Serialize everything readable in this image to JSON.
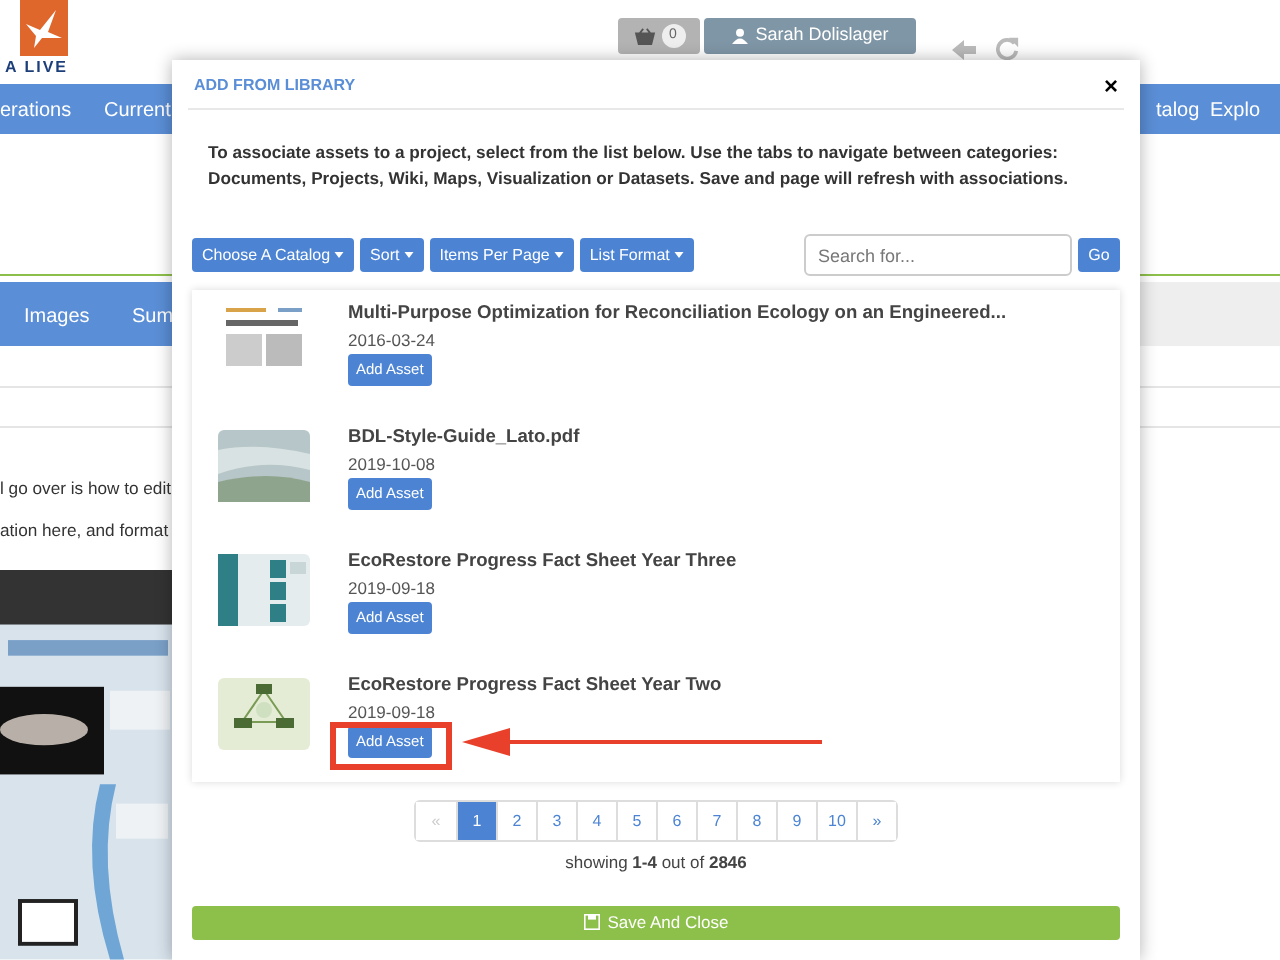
{
  "page": {
    "logo_text": "A LIVE",
    "cart_count": "0",
    "user": "Sarah Dolislager",
    "nav": [
      "erations",
      "Current",
      "talog",
      "Explo"
    ],
    "subnav": [
      "Images",
      "Sum"
    ],
    "body_lines": [
      "l go over is how to edit",
      "ation here, and format"
    ]
  },
  "modal": {
    "title": "ADD FROM LIBRARY",
    "close": "×",
    "description": "To associate assets to a project, select from the list below. Use the tabs to navigate between categories: Documents, Projects, Wiki, Maps, Visualization or Datasets. Save and page will refresh with associations.",
    "toolbar": [
      "Choose A Catalog",
      "Sort",
      "Items Per Page",
      "List Format"
    ],
    "search": {
      "placeholder": "Search for...",
      "button": "Go"
    },
    "assets": [
      {
        "title": "Multi-Purpose Optimization for Reconciliation Ecology on an Engineered...",
        "date": "2016-03-24",
        "button": "Add Asset",
        "highlighted": false
      },
      {
        "title": "BDL-Style-Guide_Lato.pdf",
        "date": "2019-10-08",
        "button": "Add Asset",
        "highlighted": false
      },
      {
        "title": "EcoRestore Progress Fact Sheet Year Three",
        "date": "2019-09-18",
        "button": "Add Asset",
        "highlighted": false
      },
      {
        "title": "EcoRestore Progress Fact Sheet Year Two",
        "date": "2019-09-18",
        "button": "Add Asset",
        "highlighted": true
      }
    ],
    "pagination": [
      {
        "label": "«",
        "selected": false,
        "disabled": true
      },
      {
        "label": "1",
        "selected": true,
        "disabled": false
      },
      {
        "label": "2",
        "selected": false,
        "disabled": false
      },
      {
        "label": "3",
        "selected": false,
        "disabled": false
      },
      {
        "label": "4",
        "selected": false,
        "disabled": false
      },
      {
        "label": "5",
        "selected": false,
        "disabled": false
      },
      {
        "label": "6",
        "selected": false,
        "disabled": false
      },
      {
        "label": "7",
        "selected": false,
        "disabled": false
      },
      {
        "label": "8",
        "selected": false,
        "disabled": false
      },
      {
        "label": "9",
        "selected": false,
        "disabled": false
      },
      {
        "label": "10",
        "selected": false,
        "disabled": false
      },
      {
        "label": "»",
        "selected": false,
        "disabled": false
      }
    ],
    "summary": "showing **1-4** out of **2846**",
    "save_button": "Save And Close"
  }
}
